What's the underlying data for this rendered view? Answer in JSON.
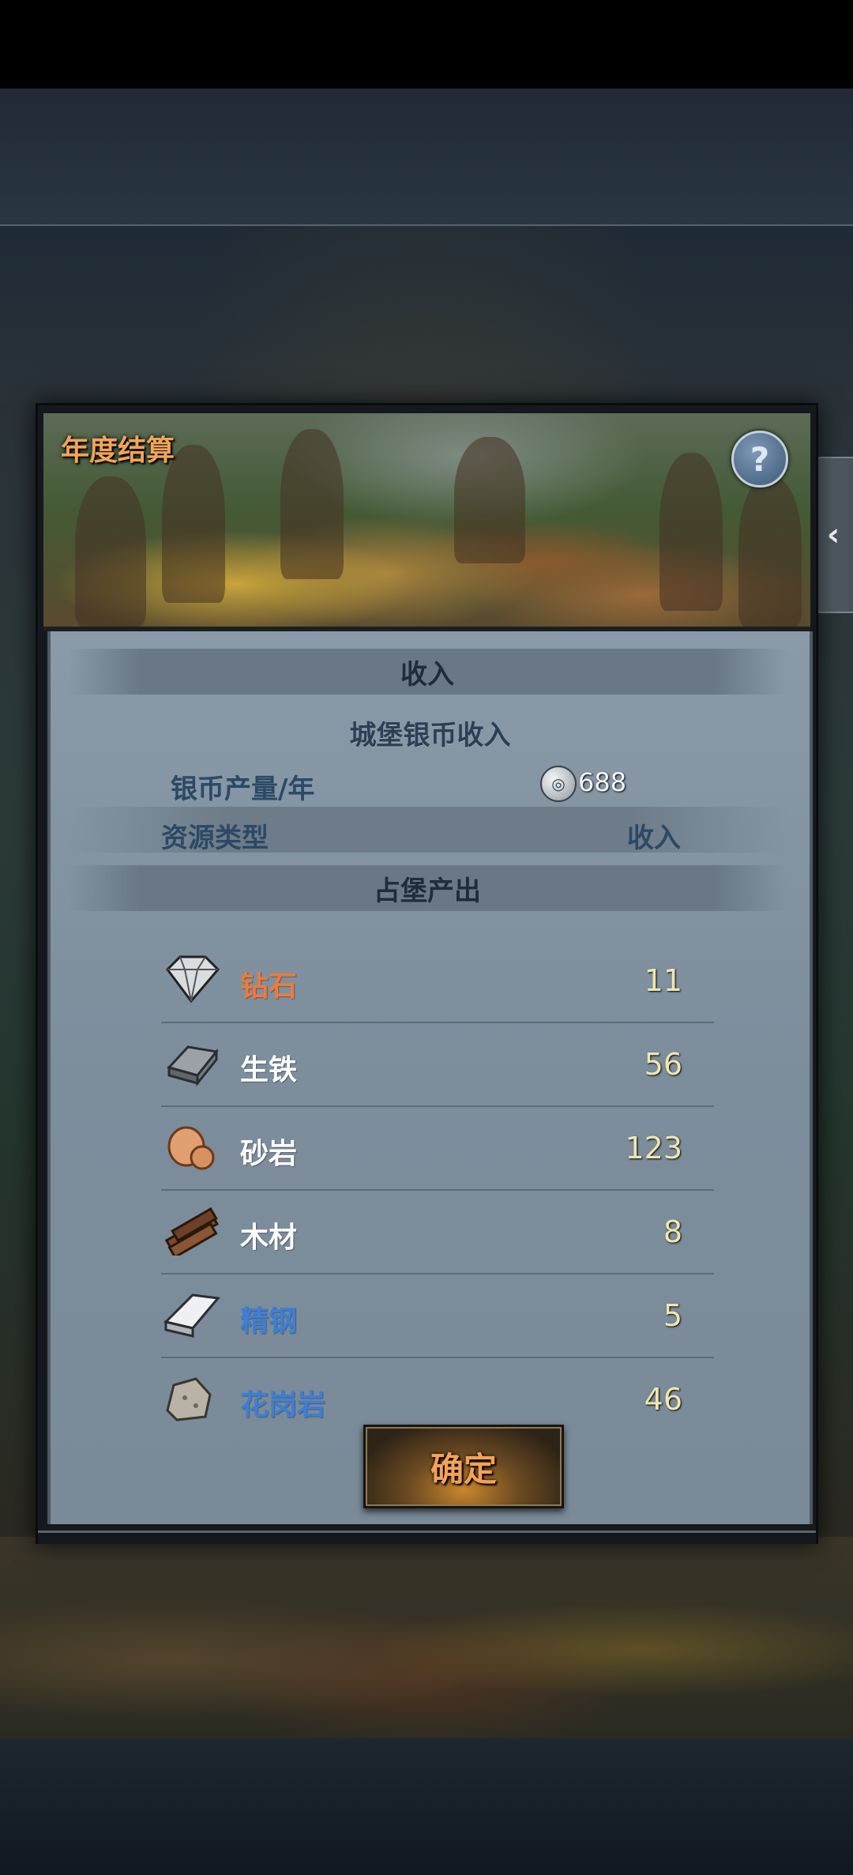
{
  "dialog": {
    "title": "年度结算",
    "help_glyph": "?",
    "income_header": "收入",
    "castle_income_title": "城堡银币收入",
    "silver_label": "银币产量/年",
    "silver_value": "688",
    "col_resource": "资源类型",
    "col_income": "收入",
    "output_header": "占堡产出",
    "confirm_label": "确定"
  },
  "resources": [
    {
      "name": "钻石",
      "qty": "11",
      "color": "#f07a3a",
      "icon": "diamond-icon"
    },
    {
      "name": "生铁",
      "qty": "56",
      "color": "#ffffff",
      "icon": "iron-ingot-icon"
    },
    {
      "name": "砂岩",
      "qty": "123",
      "color": "#ffffff",
      "icon": "sandstone-icon"
    },
    {
      "name": "木材",
      "qty": "8",
      "color": "#ffffff",
      "icon": "wood-icon"
    },
    {
      "name": "精钢",
      "qty": "5",
      "color": "#3d7fd6",
      "icon": "steel-icon"
    },
    {
      "name": "花岗岩",
      "qty": "46",
      "color": "#3d7fd6",
      "icon": "granite-icon"
    }
  ],
  "side_tab_glyph": "‹"
}
